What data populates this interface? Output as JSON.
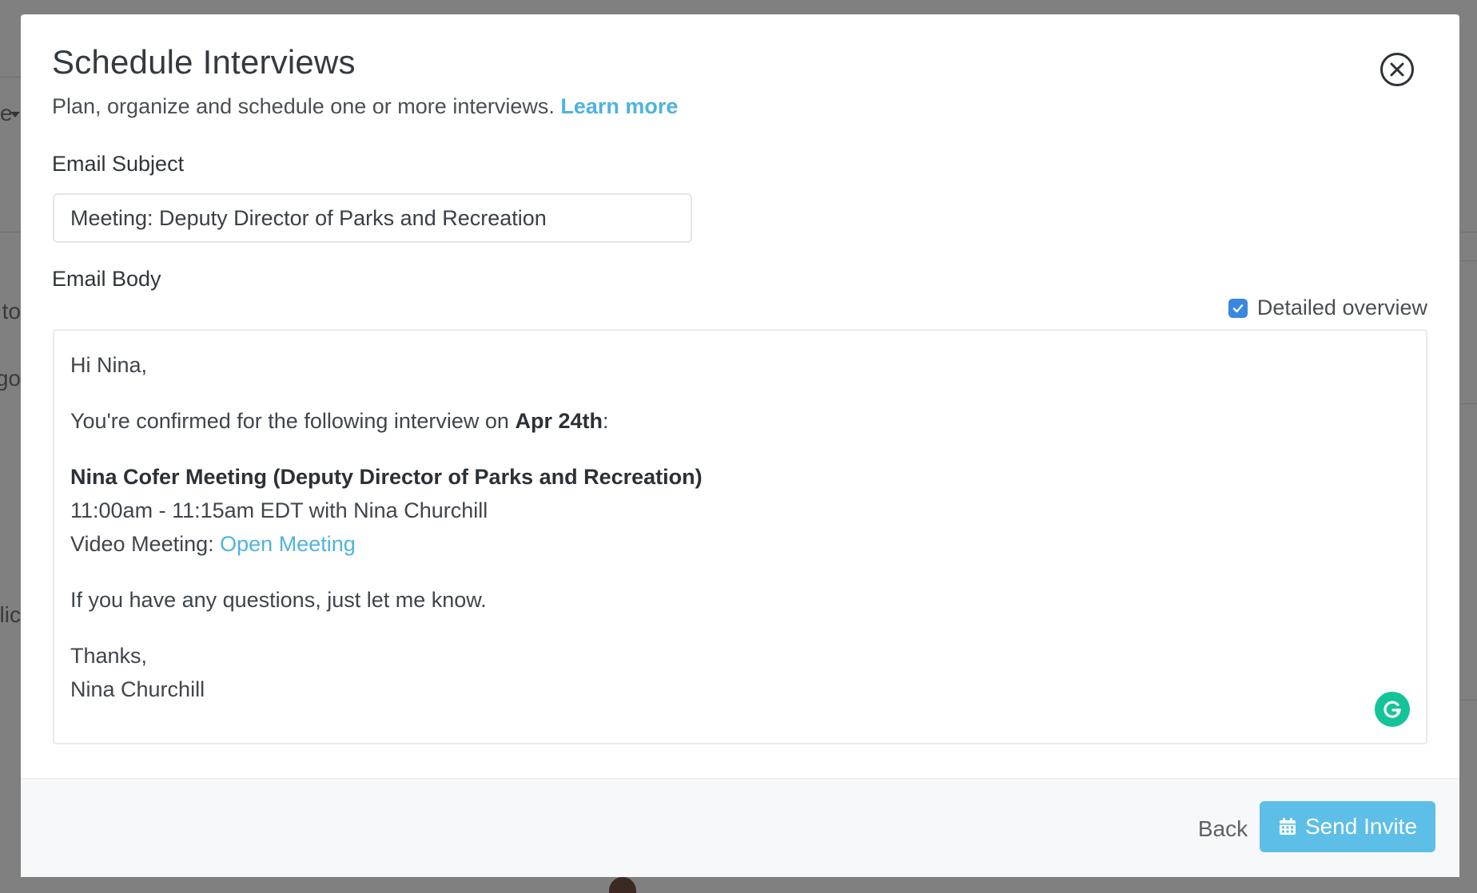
{
  "background": {
    "fragments": [
      "e",
      "y to",
      "go",
      "Clic"
    ]
  },
  "modal": {
    "title": "Schedule Interviews",
    "subtitle": "Plan, organize and schedule one or more interviews.",
    "learn_more": "Learn more",
    "close_icon": "circle-x-icon"
  },
  "email_subject": {
    "label": "Email Subject",
    "value": "Meeting: Deputy Director of Parks and Recreation"
  },
  "email_body": {
    "label": "Email Body",
    "detailed_overview_label": "Detailed overview",
    "detailed_overview_checked": true,
    "greeting": "Hi Nina,",
    "confirm_prefix": "You're confirmed for the following interview on ",
    "confirm_date": "Apr 24th",
    "confirm_suffix": ":",
    "meeting_title": "Nina Cofer Meeting (Deputy Director of Parks and Recreation)",
    "meeting_time": "11:00am - 11:15am EDT with Nina Churchill",
    "video_prefix": "Video Meeting: ",
    "video_link": "Open Meeting",
    "questions": "If you have any questions, just let me know.",
    "signoff": "Thanks,",
    "signature": "Nina Churchill",
    "grammarly_icon": "grammarly-icon"
  },
  "footer": {
    "back_label": "Back",
    "send_label": "Send Invite",
    "send_icon": "calendar-icon"
  },
  "colors": {
    "accent": "#4fb3de",
    "primary_button": "#5dbfe8",
    "checkbox": "#3a87e0",
    "grammarly": "#15c39a"
  }
}
